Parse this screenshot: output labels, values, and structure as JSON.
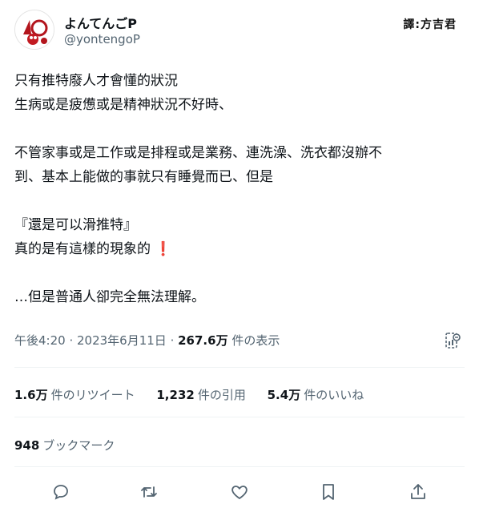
{
  "user": {
    "display_name": "よんてんごP",
    "handle": "@yontengoP",
    "watermark": "譯:方吉君"
  },
  "tweet": {
    "lines": [
      "只有推特廢人才會懂的狀況",
      "生病或是疲憊或是精神狀況不好時、",
      "",
      "不管家事或是工作或是排程或是業務、連洗澡、洗衣都沒辦不",
      "到、基本上能做的事就只有睡覺而已、但是",
      "",
      "『還是可以滑推特』",
      "真的是有這樣的現象的",
      "",
      "…但是普通人卻完全無法理解。"
    ],
    "exclamation": "❗"
  },
  "meta": {
    "time": "午後4:20",
    "sep1": " · ",
    "date": "2023年6月11日",
    "sep2": " · ",
    "views": "267.6万",
    "views_label": " 件の表示"
  },
  "stats": {
    "retweets": "1.6万",
    "retweets_label": "件のリツイート",
    "quotes": "1,232",
    "quotes_label": "件の引用",
    "likes": "5.4万",
    "likes_label": "件のいいね"
  },
  "bookmarks": {
    "count": "948",
    "label": "ブックマーク"
  },
  "icons": {
    "reply": "reply-icon",
    "retweet": "retweet-icon",
    "like": "heart-icon",
    "bookmark": "bookmark-icon",
    "share": "share-icon",
    "analytics": "analytics-icon"
  },
  "colors": {
    "text": "#0f1419",
    "secondary": "#536471",
    "exclamation": "#d01f2f"
  }
}
